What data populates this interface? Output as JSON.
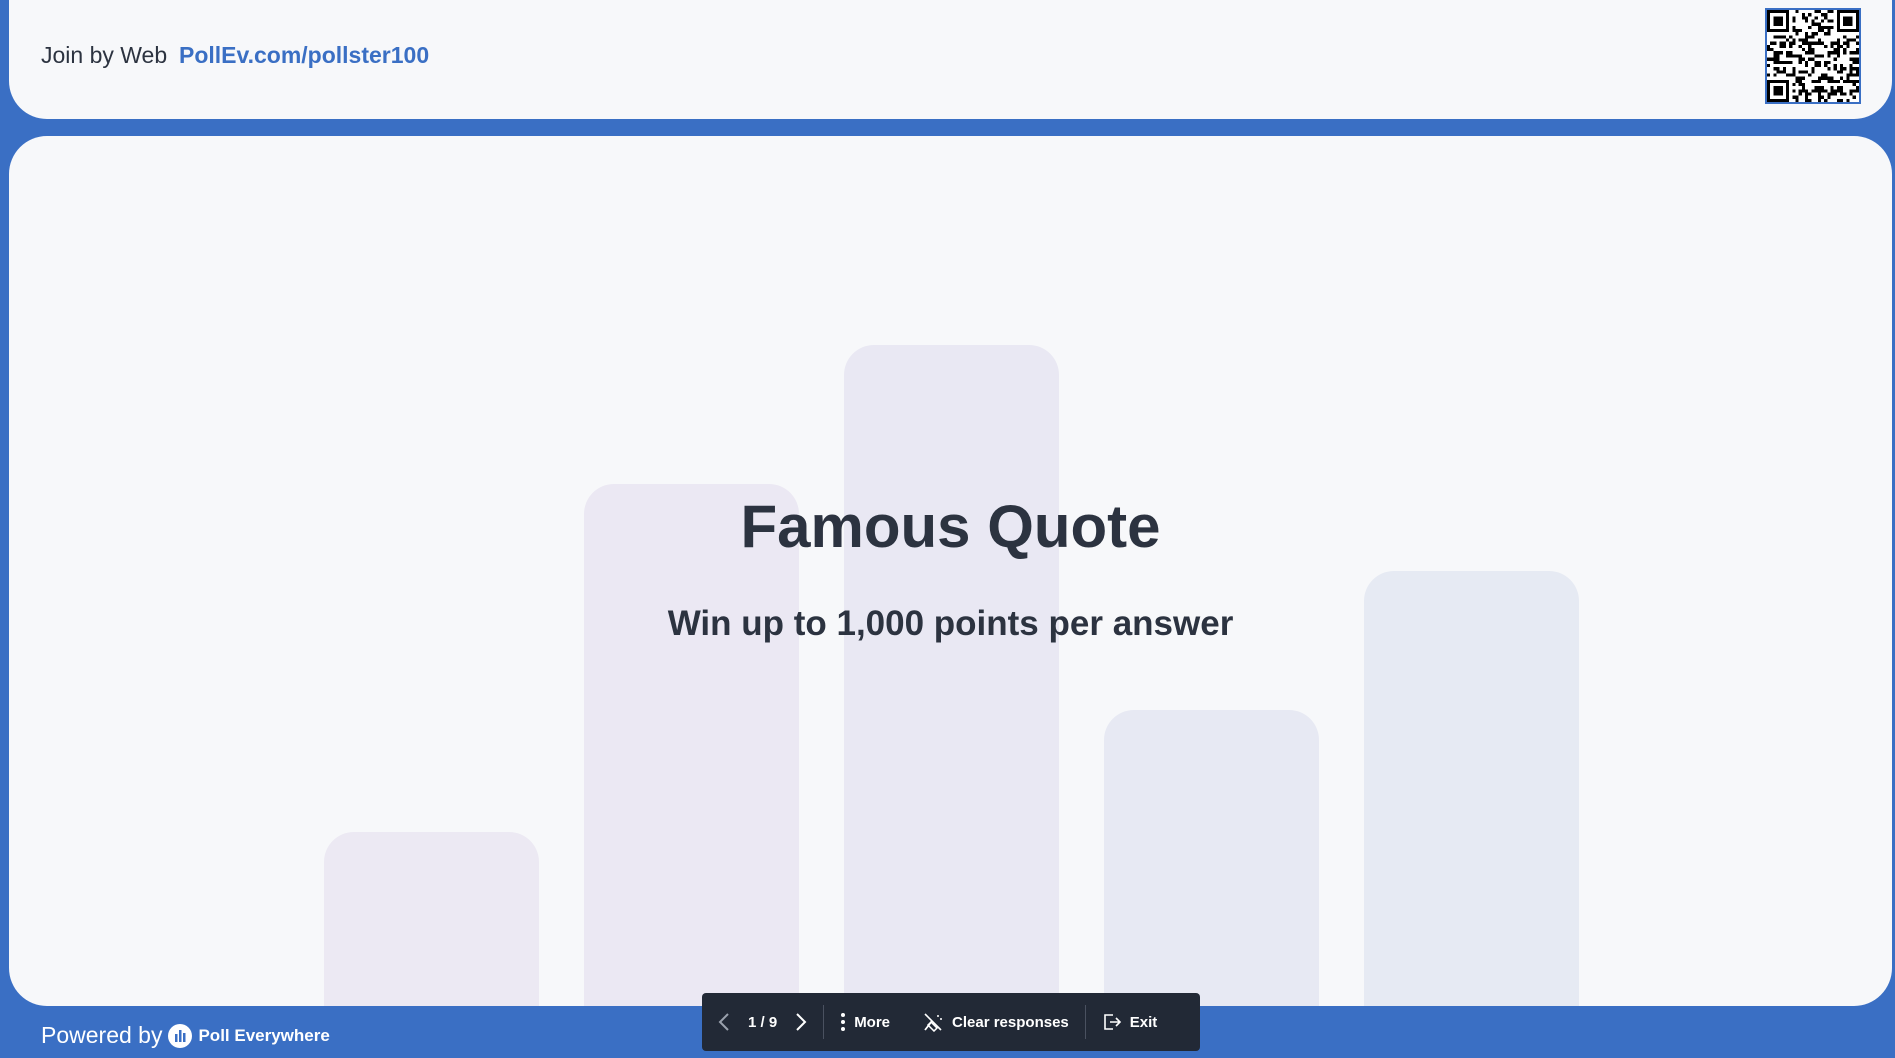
{
  "header": {
    "join_label": "Join by Web",
    "join_url": "PollEv.com/pollster100"
  },
  "slide": {
    "title": "Famous Quote",
    "subtitle": "Win up to 1,000 points per answer",
    "decorative_bars": [
      {
        "level": 0.2,
        "color": "#ece9f3"
      },
      {
        "level": 0.6,
        "color": "#ebe8f3"
      },
      {
        "level": 0.76,
        "color": "#e9e8f3"
      },
      {
        "level": 0.34,
        "color": "#e7e9f3"
      },
      {
        "level": 0.5,
        "color": "#e6eaf3"
      }
    ]
  },
  "footer": {
    "powered_label": "Powered by",
    "brand_name": "Poll Everywhere"
  },
  "toolbar": {
    "page_indicator": "1 / 9",
    "more_label": "More",
    "clear_label": "Clear responses",
    "exit_label": "Exit"
  },
  "colors": {
    "accent": "#3a6fc4",
    "surface": "#f7f8fa",
    "text": "#2c3340",
    "toolbar_bg": "#222936"
  }
}
